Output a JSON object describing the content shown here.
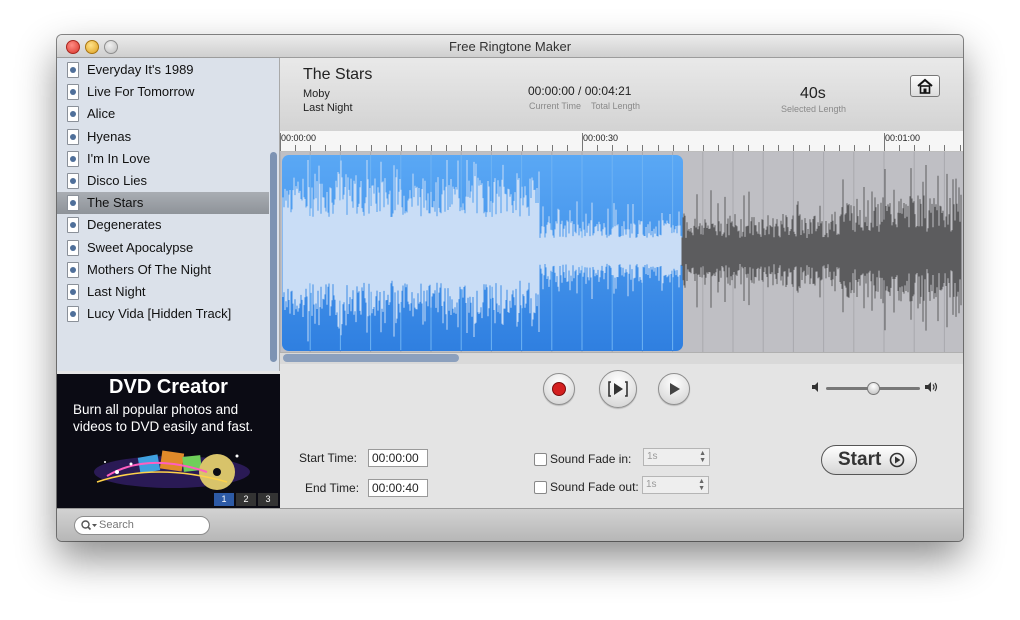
{
  "window": {
    "title": "Free Ringtone Maker"
  },
  "sidebar": {
    "selected_index": 6,
    "tracks": [
      {
        "label": "Everyday It's 1989"
      },
      {
        "label": "Live For Tomorrow"
      },
      {
        "label": "Alice"
      },
      {
        "label": "Hyenas"
      },
      {
        "label": "I'm In Love"
      },
      {
        "label": "Disco Lies"
      },
      {
        "label": "The Stars"
      },
      {
        "label": "Degenerates"
      },
      {
        "label": "Sweet Apocalypse"
      },
      {
        "label": "Mothers Of The Night"
      },
      {
        "label": "Last Night"
      },
      {
        "label": "Lucy Vida [Hidden Track]"
      }
    ]
  },
  "ad": {
    "title": "DVD Creator",
    "text": "Burn all popular photos and videos to DVD easily and fast.",
    "pages": [
      "1",
      "2",
      "3"
    ],
    "active_page": 0
  },
  "header": {
    "song_title": "The Stars",
    "artist": "Moby",
    "album": "Last Night",
    "time_value": "00:00:00 / 00:04:21",
    "current_time_label": "Current Time",
    "total_length_label": "Total Length",
    "selected_length": "40s",
    "selected_length_label": "Selected Length"
  },
  "timeline": {
    "labels": [
      "00:00:00",
      "00:00:30",
      "00:01:00"
    ],
    "selection_fraction": 0.59,
    "scroll_fraction": 0.26
  },
  "controls": {
    "start_time_label": "Start Time:",
    "start_time_value": "00:00:00",
    "end_time_label": "End Time:",
    "end_time_value": "00:00:40",
    "fade_in_label": "Sound Fade in:",
    "fade_in_value": "1s",
    "fade_out_label": "Sound Fade out:",
    "fade_out_value": "1s",
    "start_button_label": "Start",
    "volume_fraction": 0.5
  },
  "icons": {
    "record": "record-icon",
    "play_selection": "play-selection-icon",
    "play": "play-icon",
    "home": "home-icon",
    "search": "search-icon",
    "volume_low": "volume-low-icon",
    "volume_high": "volume-high-icon"
  },
  "colors": {
    "selection_blue": "#3a8ee8",
    "record_red": "#d42020",
    "sidebar_bg": "#dbe1ea",
    "selected_row": "#9da2a8"
  },
  "search": {
    "placeholder": "Search"
  }
}
